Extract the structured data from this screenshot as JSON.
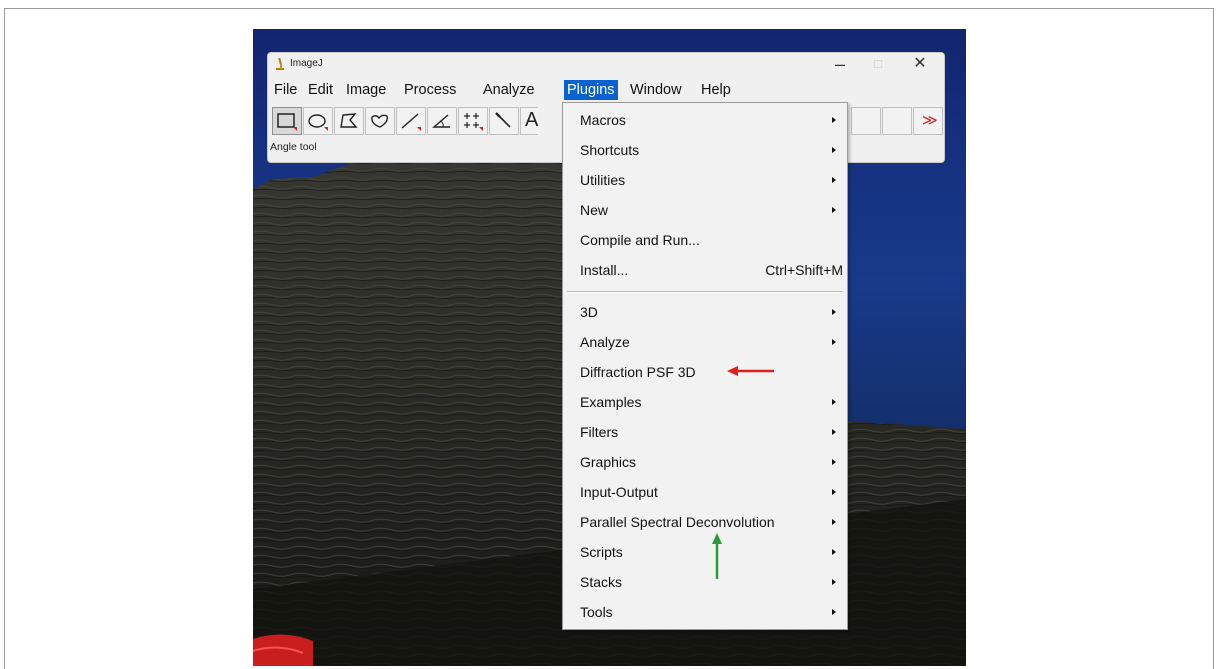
{
  "window": {
    "title": "ImageJ",
    "min_glyph": "–",
    "max_glyph": "□",
    "close_glyph": "✕"
  },
  "menubar": {
    "items": [
      "File",
      "Edit",
      "Image",
      "Process",
      "Analyze",
      "Plugins",
      "Window",
      "Help"
    ],
    "active": "Plugins"
  },
  "toolbar": {
    "text_tool_glyph": "A",
    "more_tools_glyph": "≫"
  },
  "status_text": "Angle tool",
  "plugins_menu": {
    "items": [
      {
        "label": "Macros",
        "submenu": true
      },
      {
        "label": "Shortcuts",
        "submenu": true
      },
      {
        "label": "Utilities",
        "submenu": true
      },
      {
        "label": "New",
        "submenu": true
      },
      {
        "label": "Compile and Run...",
        "submenu": false
      },
      {
        "label": "Install...",
        "submenu": false,
        "shortcut": "Ctrl+Shift+M"
      },
      {
        "label": "3D",
        "submenu": true
      },
      {
        "label": "Analyze",
        "submenu": true
      },
      {
        "label": "Diffraction PSF 3D",
        "submenu": false
      },
      {
        "label": "Examples",
        "submenu": true
      },
      {
        "label": "Filters",
        "submenu": true
      },
      {
        "label": "Graphics",
        "submenu": true
      },
      {
        "label": "Input-Output",
        "submenu": true
      },
      {
        "label": "Parallel Spectral Deconvolution",
        "submenu": true
      },
      {
        "label": "Scripts",
        "submenu": true
      },
      {
        "label": "Stacks",
        "submenu": true
      },
      {
        "label": "Tools",
        "submenu": true
      }
    ]
  },
  "colors": {
    "menu_highlight": "#0a62d0",
    "red_arrow": "#e0201a",
    "green_arrow": "#2a9a3a"
  }
}
